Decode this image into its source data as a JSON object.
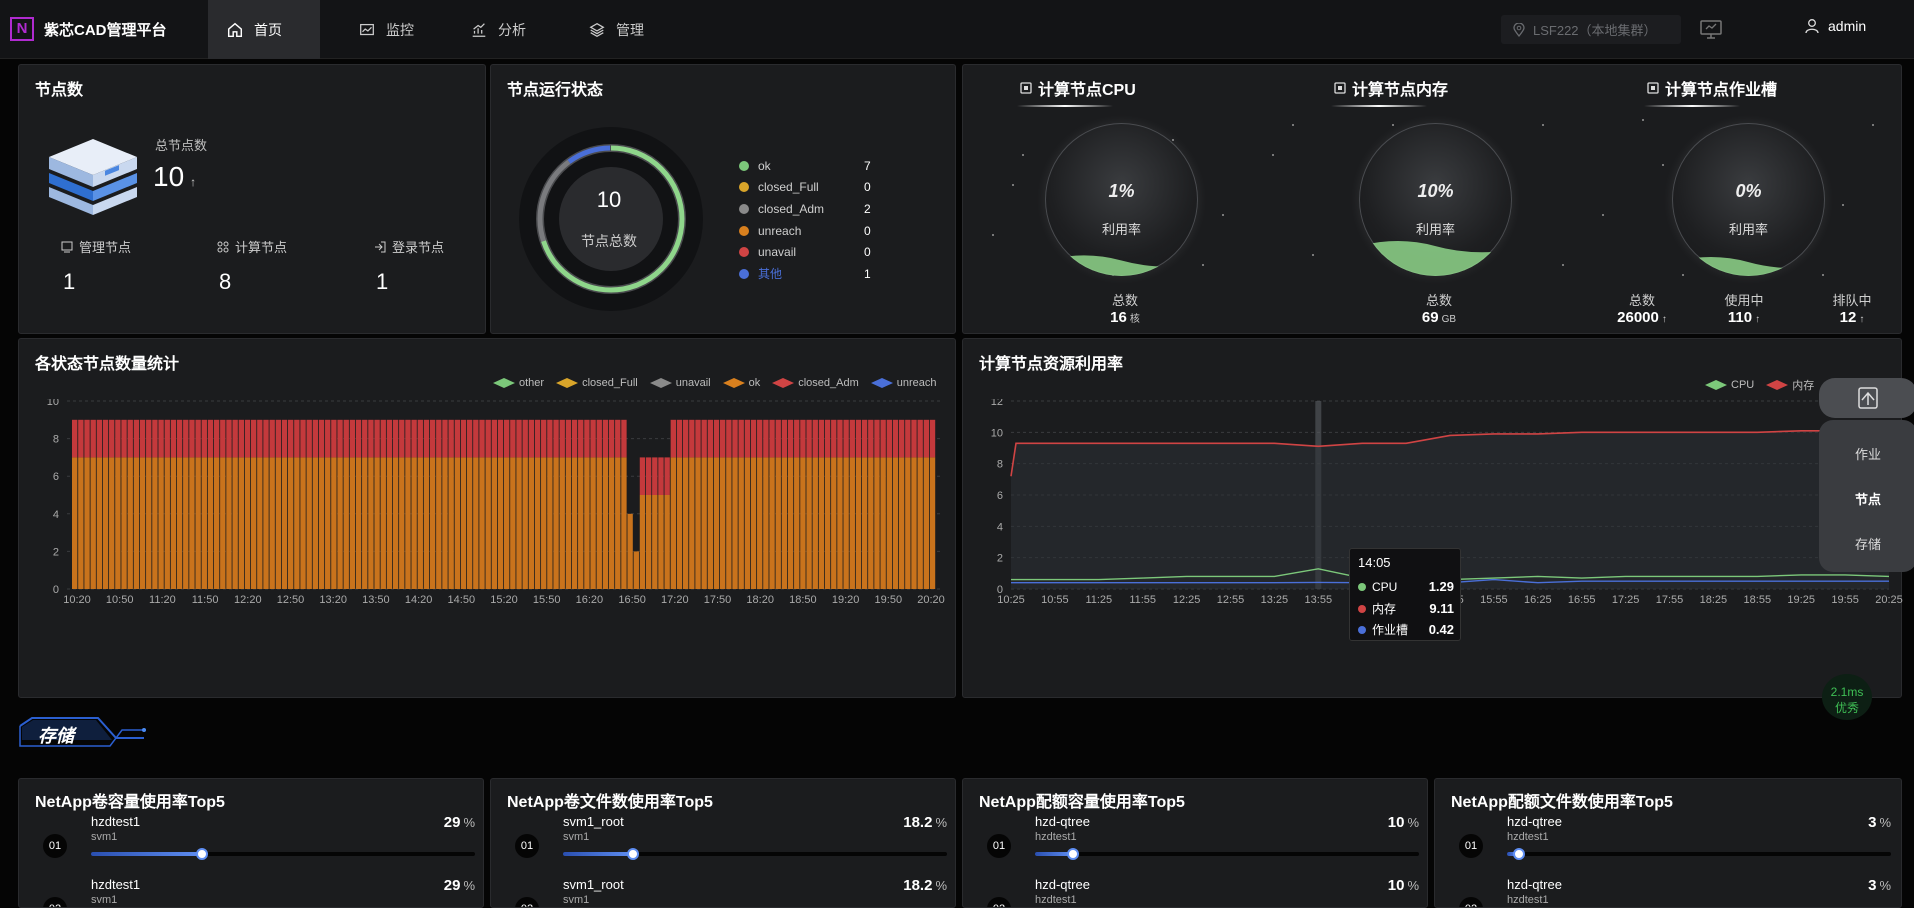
{
  "app": {
    "logo_letter": "N",
    "title": "紫芯CAD管理平台"
  },
  "nav": [
    {
      "label": "首页",
      "icon": "home-icon",
      "active": true
    },
    {
      "label": "监控",
      "icon": "monitor-icon"
    },
    {
      "label": "分析",
      "icon": "analysis-icon"
    },
    {
      "label": "管理",
      "icon": "layers-icon"
    }
  ],
  "cluster_selector": {
    "value": "LSF222（本地集群）"
  },
  "user": {
    "name": "admin"
  },
  "node_count": {
    "title": "节点数",
    "total_label": "总节点数",
    "total_value": "10",
    "total_trend": "↑",
    "sub": [
      {
        "label": "管理节点",
        "value": "1"
      },
      {
        "label": "计算节点",
        "value": "8"
      },
      {
        "label": "登录节点",
        "value": "1"
      }
    ]
  },
  "node_status": {
    "title": "节点运行状态",
    "center_value": "10",
    "center_label": "节点总数",
    "items": [
      {
        "name": "ok",
        "value": "7",
        "color": "#7cc87a"
      },
      {
        "name": "closed_Full",
        "value": "0",
        "color": "#d9a52a"
      },
      {
        "name": "closed_Adm",
        "value": "2",
        "color": "#8a8a8a"
      },
      {
        "name": "unreach",
        "value": "0",
        "color": "#d9801e"
      },
      {
        "name": "unavail",
        "value": "0",
        "color": "#d04444"
      },
      {
        "name": "其他",
        "value": "1",
        "color": "#4a6fd8"
      }
    ]
  },
  "gauges": [
    {
      "title": "计算节点CPU",
      "icon": "cpu-icon",
      "percent": 1,
      "pct_text": "1%",
      "label": "利用率",
      "stats": [
        {
          "label": "总数",
          "value": "16",
          "unit": "核"
        }
      ]
    },
    {
      "title": "计算节点内存",
      "icon": "memory-icon",
      "percent": 10,
      "pct_text": "10%",
      "label": "利用率",
      "stats": [
        {
          "label": "总数",
          "value": "69",
          "unit": "GB"
        }
      ]
    },
    {
      "title": "计算节点作业槽",
      "icon": "slot-icon",
      "percent": 0,
      "pct_text": "0%",
      "label": "利用率",
      "stats": [
        {
          "label": "总数",
          "value": "26000",
          "unit": "↑"
        },
        {
          "label": "使用中",
          "value": "110",
          "unit": "↑"
        },
        {
          "label": "排队中",
          "value": "12",
          "unit": "↑"
        }
      ]
    }
  ],
  "status_chart": {
    "title": "各状态节点数量统计",
    "legend": [
      {
        "name": "other",
        "color": "#7cc87a"
      },
      {
        "name": "closed_Full",
        "color": "#d9a52a"
      },
      {
        "name": "unavail",
        "color": "#8a8a8a"
      },
      {
        "name": "ok",
        "color": "#d9801e"
      },
      {
        "name": "closed_Adm",
        "color": "#d04444"
      },
      {
        "name": "unreach",
        "color": "#4a6fd8"
      }
    ]
  },
  "resource_chart": {
    "title": "计算节点资源利用率",
    "legend": [
      {
        "name": "CPU",
        "color": "#7cc87a"
      },
      {
        "name": "内存",
        "color": "#d04444"
      },
      {
        "name": "作业槽",
        "color": "#4a6fd8"
      }
    ],
    "tooltip": {
      "time": "14:05",
      "rows": [
        {
          "name": "CPU",
          "value": "1.29",
          "color": "#7cc87a"
        },
        {
          "name": "内存",
          "value": "9.11",
          "color": "#d04444"
        },
        {
          "name": "作业槽",
          "value": "0.42",
          "color": "#4a6fd8"
        }
      ]
    }
  },
  "chart_data": [
    {
      "type": "bar",
      "title": "各状态节点数量统计",
      "x": [
        "10:20",
        "10:50",
        "11:20",
        "11:50",
        "12:20",
        "12:50",
        "13:20",
        "13:50",
        "14:20",
        "14:50",
        "15:20",
        "15:50",
        "16:20",
        "16:50",
        "17:20",
        "17:50",
        "18:20",
        "18:50",
        "19:20",
        "19:50",
        "20:20"
      ],
      "ylim": [
        0,
        10
      ],
      "yticks": [
        0,
        2,
        4,
        6,
        8,
        10
      ],
      "stacked": true,
      "series": [
        {
          "name": "ok",
          "value": 7,
          "dip": [
            {
              "range": "~17:10",
              "value": 4
            },
            {
              "range": "17:15-17:40",
              "value": 5
            }
          ]
        },
        {
          "name": "closed_Adm",
          "value": 2
        }
      ]
    },
    {
      "type": "line",
      "title": "计算节点资源利用率",
      "x": [
        "10:25",
        "10:55",
        "11:25",
        "11:55",
        "12:25",
        "12:55",
        "13:25",
        "13:55",
        "14:25",
        "14:55",
        "15:25",
        "15:55",
        "16:25",
        "16:55",
        "17:25",
        "17:55",
        "18:25",
        "18:55",
        "19:25",
        "19:55",
        "20:25"
      ],
      "ylim": [
        0,
        12
      ],
      "yticks": [
        0,
        2,
        4,
        6,
        8,
        10,
        12
      ],
      "series": [
        {
          "name": "CPU",
          "values": [
            0.6,
            0.6,
            0.6,
            0.7,
            0.8,
            0.8,
            0.8,
            1.29,
            0.7,
            0.7,
            0.6,
            0.7,
            0.8,
            0.7,
            0.8,
            0.8,
            0.8,
            0.8,
            0.9,
            0.9,
            0.8
          ]
        },
        {
          "name": "内存",
          "values": [
            9.3,
            9.3,
            9.3,
            9.3,
            9.3,
            9.3,
            9.3,
            9.11,
            9.3,
            9.3,
            9.8,
            9.9,
            9.9,
            10.0,
            10.0,
            10.0,
            10.0,
            10.0,
            10.1,
            10.1,
            10.1
          ]
        },
        {
          "name": "作业槽",
          "values": [
            0.4,
            0.4,
            0.4,
            0.4,
            0.4,
            0.4,
            0.4,
            0.42,
            0.4,
            0.4,
            0.4,
            0.6,
            0.4,
            0.5,
            0.5,
            0.5,
            0.5,
            0.5,
            0.5,
            0.5,
            0.5
          ]
        }
      ]
    }
  ],
  "side_panel": {
    "options": [
      "作业",
      "节点",
      "存储"
    ]
  },
  "latency": {
    "value": "2.1ms",
    "status": "优秀"
  },
  "storage_section": {
    "title": "存储"
  },
  "top5": [
    {
      "title": "NetApp卷容量使用率Top5",
      "items": [
        {
          "rank": "01",
          "name": "hzdtest1",
          "sub": "svm1",
          "percent": 29,
          "value": "29",
          "unit": "%"
        },
        {
          "rank": "02",
          "name": "hzdtest1",
          "sub": "svm1",
          "percent": 29,
          "value": "29",
          "unit": "%"
        }
      ]
    },
    {
      "title": "NetApp卷文件数使用率Top5",
      "items": [
        {
          "rank": "01",
          "name": "svm1_root",
          "sub": "svm1",
          "percent": 18.2,
          "value": "18.2",
          "unit": "%"
        },
        {
          "rank": "02",
          "name": "svm1_root",
          "sub": "svm1",
          "percent": 18.2,
          "value": "18.2",
          "unit": "%"
        }
      ]
    },
    {
      "title": "NetApp配额容量使用率Top5",
      "items": [
        {
          "rank": "01",
          "name": "hzd-qtree",
          "sub": "hzdtest1",
          "percent": 10,
          "value": "10",
          "unit": "%"
        },
        {
          "rank": "02",
          "name": "hzd-qtree",
          "sub": "hzdtest1",
          "percent": 10,
          "value": "10",
          "unit": "%"
        }
      ]
    },
    {
      "title": "NetApp配额文件数使用率Top5",
      "items": [
        {
          "rank": "01",
          "name": "hzd-qtree",
          "sub": "hzdtest1",
          "percent": 3,
          "value": "3",
          "unit": "%"
        },
        {
          "rank": "02",
          "name": "hzd-qtree",
          "sub": "hzdtest1",
          "percent": 3,
          "value": "3",
          "unit": "%"
        }
      ]
    }
  ]
}
